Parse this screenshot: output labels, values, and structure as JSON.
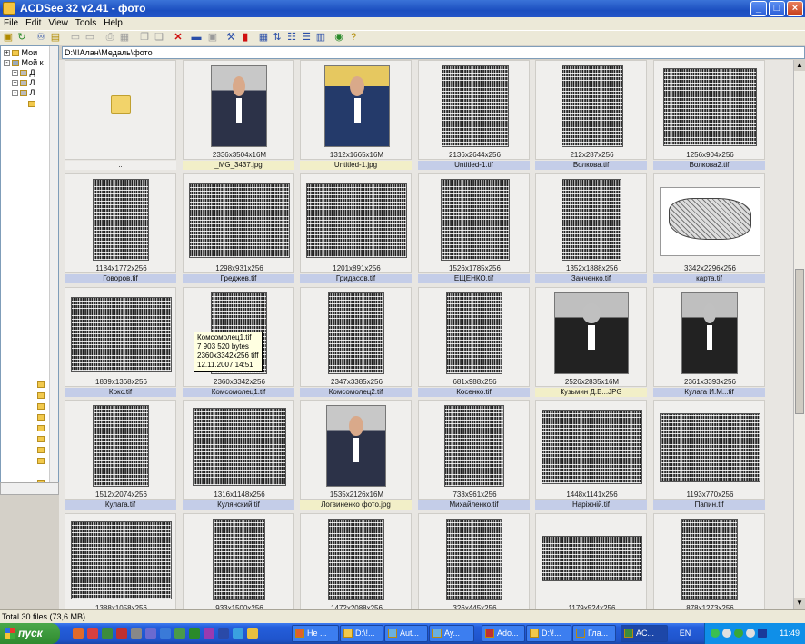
{
  "window": {
    "title": "ACDSee 32 v2.41 - фото",
    "min": "_",
    "max": "□",
    "close": "×"
  },
  "menu": [
    "File",
    "Edit",
    "View",
    "Tools",
    "Help"
  ],
  "tree": {
    "items": [
      {
        "expander": "+",
        "label": "Мои"
      },
      {
        "expander": "-",
        "label": "Мой к"
      },
      {
        "expander": "+",
        "label": "Д"
      },
      {
        "expander": "+",
        "label": "Л"
      },
      {
        "expander": "-",
        "label": "Л"
      }
    ]
  },
  "path": "D:\\!!Алан\\Медаль\\фото",
  "thumbnails": [
    {
      "kind": "folder",
      "dims": "",
      "label": ".."
    },
    {
      "kind": "photo",
      "dims": "2336x3504x16M",
      "label": "_MG_3437.jpg"
    },
    {
      "kind": "photo",
      "dims": "1312x1665x16M",
      "label": "Untitled-1.jpg"
    },
    {
      "kind": "scan",
      "dims": "2136x2644x256",
      "label": "Untitled-1.tif"
    },
    {
      "kind": "scan",
      "dims": "212x287x256",
      "label": "Волкова.tif"
    },
    {
      "kind": "scan",
      "dims": "1256x904x256",
      "label": "Волкова2.tif"
    },
    {
      "kind": "scan",
      "dims": "1184x1772x256",
      "label": "Говоров.tif"
    },
    {
      "kind": "scan",
      "dims": "1298x931x256",
      "label": "Греджев.tif"
    },
    {
      "kind": "scan",
      "dims": "1201x891x256",
      "label": "Гридасов.tif"
    },
    {
      "kind": "scan",
      "dims": "1526x1785x256",
      "label": "ЕЩЕНКО.tif"
    },
    {
      "kind": "scan",
      "dims": "1352x1888x256",
      "label": "Занченко.tif"
    },
    {
      "kind": "map",
      "dims": "3342x2296x256",
      "label": "карта.tif"
    },
    {
      "kind": "scan",
      "dims": "1839x1368x256",
      "label": "Кокс.tif"
    },
    {
      "kind": "scan",
      "dims": "2360x3342x256",
      "label": "Комсомолец1.tif"
    },
    {
      "kind": "scan",
      "dims": "2347x3385x256",
      "label": "Комсомолец2.tif"
    },
    {
      "kind": "scan",
      "dims": "681x988x256",
      "label": "Косенко.tif"
    },
    {
      "kind": "photo",
      "dims": "2526x2835x16M",
      "label": "Кузьмин Д.В...JPG"
    },
    {
      "kind": "photo",
      "dims": "2361x3393x256",
      "label": "Кулага И.М...tif"
    },
    {
      "kind": "scan",
      "dims": "1512x2074x256",
      "label": "Кулага.tif"
    },
    {
      "kind": "scan",
      "dims": "1316x1148x256",
      "label": "Кулянский.tif"
    },
    {
      "kind": "photo",
      "dims": "1535x2126x16M",
      "label": "Логвиненко фото.jpg"
    },
    {
      "kind": "scan",
      "dims": "733x961x256",
      "label": "Михайленко.tif"
    },
    {
      "kind": "scan",
      "dims": "1448x1141x256",
      "label": "Нарiжнiй.tif"
    },
    {
      "kind": "scan",
      "dims": "1193x770x256",
      "label": "Папин.tif"
    },
    {
      "kind": "scan",
      "dims": "1388x1058x256",
      "label": ""
    },
    {
      "kind": "scan",
      "dims": "933x1500x256",
      "label": ""
    },
    {
      "kind": "scan",
      "dims": "1472x2088x256",
      "label": ""
    },
    {
      "kind": "scan",
      "dims": "326x445x256",
      "label": ""
    },
    {
      "kind": "scan",
      "dims": "1179x524x256",
      "label": ""
    },
    {
      "kind": "scan",
      "dims": "878x1273x256",
      "label": ""
    }
  ],
  "tooltip": {
    "name": "Комсомолец1.tif",
    "size": "7 903 520 bytes",
    "info": "2360x3342x256 tiff",
    "date": "12.11.2007 14:51"
  },
  "status": "Total 30 files (73,6 MB)",
  "taskbar": {
    "start": "пуск",
    "tasks": [
      {
        "label": "Не ..."
      },
      {
        "label": "D:\\!..."
      },
      {
        "label": "Aut..."
      },
      {
        "label": "Ау..."
      },
      {
        "label": "Ado..."
      },
      {
        "label": "D:\\!..."
      },
      {
        "label": "Гла..."
      },
      {
        "label": "AC..."
      }
    ],
    "lang": "EN",
    "clock": "11:49"
  }
}
